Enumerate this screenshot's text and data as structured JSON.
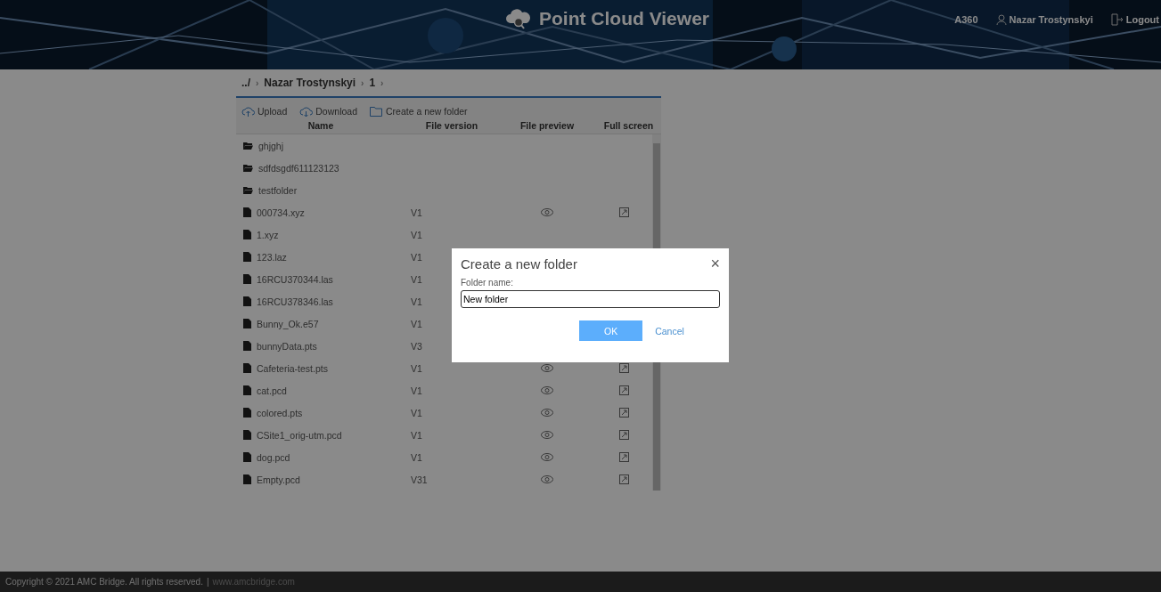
{
  "header": {
    "title": "Point Cloud Viewer",
    "nav": [
      {
        "kind": "link",
        "label": "A360"
      },
      {
        "kind": "user",
        "label": "Nazar Trostynskyi"
      },
      {
        "kind": "logout",
        "label": "Logout"
      }
    ]
  },
  "breadcrumb": {
    "separator": "›",
    "items": [
      "../",
      "Nazar Trostynskyi",
      "1"
    ]
  },
  "toolbar": [
    {
      "kind": "upload",
      "label": "Upload"
    },
    {
      "kind": "download",
      "label": "Download"
    },
    {
      "kind": "folder",
      "label": "Create a new folder"
    }
  ],
  "table": {
    "columns": [
      "Name",
      "File version",
      "File preview",
      "Full screen"
    ],
    "rows": [
      {
        "kind": "folder",
        "name": "ghjghj"
      },
      {
        "kind": "folder",
        "name": "sdfdsgdf611123123"
      },
      {
        "kind": "folder",
        "name": "testfolder"
      },
      {
        "kind": "file",
        "name": "000734.xyz",
        "version": "V1"
      },
      {
        "kind": "file",
        "name": "1.xyz",
        "version": "V1"
      },
      {
        "kind": "file",
        "name": "123.laz",
        "version": "V1"
      },
      {
        "kind": "file",
        "name": "16RCU370344.las",
        "version": "V1"
      },
      {
        "kind": "file",
        "name": "16RCU378346.las",
        "version": "V1"
      },
      {
        "kind": "file",
        "name": "Bunny_Ok.e57",
        "version": "V1"
      },
      {
        "kind": "file",
        "name": "bunnyData.pts",
        "version": "V3"
      },
      {
        "kind": "file",
        "name": "Cafeteria-test.pts",
        "version": "V1"
      },
      {
        "kind": "file",
        "name": "cat.pcd",
        "version": "V1"
      },
      {
        "kind": "file",
        "name": "colored.pts",
        "version": "V1"
      },
      {
        "kind": "file",
        "name": "CSite1_orig-utm.pcd",
        "version": "V1"
      },
      {
        "kind": "file",
        "name": "dog.pcd",
        "version": "V1"
      },
      {
        "kind": "file",
        "name": "Empty.pcd",
        "version": "V31"
      }
    ]
  },
  "dialog": {
    "title": "Create a new folder",
    "close": "×",
    "field_label": "Folder name:",
    "value": "New folder",
    "buttons": [
      {
        "kind": "primary",
        "label": "OK"
      },
      {
        "kind": "link",
        "label": "Cancel"
      }
    ]
  },
  "footer": {
    "copyright": "Copyright © 2021 AMC Bridge. All rights reserved.",
    "separator": "|",
    "link": "www.amcbridge.com"
  }
}
